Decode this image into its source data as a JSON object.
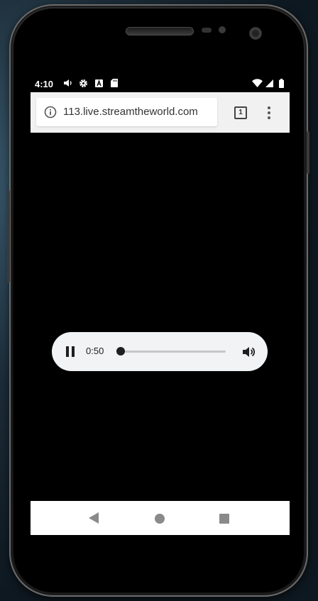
{
  "status_bar": {
    "time": "4:10",
    "left_icons": [
      "volume-icon",
      "settings-icon",
      "a-icon",
      "sd-card-icon"
    ],
    "right_icons": [
      "wifi-icon",
      "signal-icon",
      "battery-icon"
    ]
  },
  "browser": {
    "url": "113.live.streamtheworld.com",
    "tab_count": "1"
  },
  "media_player": {
    "current_time": "0:50",
    "state": "playing",
    "progress_fraction": 0.0
  },
  "nav_bar": {
    "buttons": [
      "back",
      "home",
      "recents"
    ]
  }
}
